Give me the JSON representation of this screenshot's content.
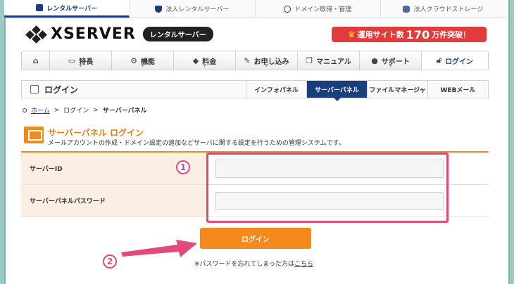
{
  "service_tabs": [
    {
      "label": "レンタルサーバー",
      "icon": "server-icon",
      "active": true
    },
    {
      "label": "法人レンタルサーバー",
      "icon": "shield-icon",
      "active": false
    },
    {
      "label": "ドメイン取得・管理",
      "icon": "globe-icon",
      "active": false
    },
    {
      "label": "法人クラウドストレージ",
      "icon": "database-icon",
      "active": false
    }
  ],
  "header": {
    "logo_text": "XSERVER",
    "logo_badge": "レンタルサーバー",
    "promo_prefix": "運用サイト数",
    "promo_number": "170",
    "promo_suffix": "万件突破！"
  },
  "main_nav": [
    {
      "label": "",
      "icon": "home-icon"
    },
    {
      "label": "特長",
      "icon": "monitor-icon"
    },
    {
      "label": "機能",
      "icon": "tools-icon"
    },
    {
      "label": "料金",
      "icon": "tag-icon"
    },
    {
      "label": "お申し込み",
      "icon": "pen-icon"
    },
    {
      "label": "マニュアル",
      "icon": "book-icon"
    },
    {
      "label": "サポート",
      "icon": "user-icon"
    },
    {
      "label": "ログイン",
      "icon": "lock-icon"
    }
  ],
  "subheader": {
    "title": "ログイン",
    "tabs": [
      "インフォパネル",
      "サーバーパネル",
      "ファイルマネージャ",
      "WEBメール"
    ],
    "active_tab": "サーバーパネル"
  },
  "breadcrumb": {
    "home": "ホーム",
    "login": "ログイン",
    "current": "サーバーパネル",
    "sep": ">"
  },
  "panel": {
    "title": "サーバーパネル ログイン",
    "description": "メールアカウントの作成・ドメイン設定の追加などサーバに関する設定を行うための管理システムです。"
  },
  "form": {
    "server_id_label": "サーバーID",
    "password_label": "サーバーパネルパスワード",
    "server_id_value": "",
    "password_value": ""
  },
  "login_button": "ログイン",
  "forgot": {
    "text": "※パスワードを忘れてしまった方は",
    "link": "こちら"
  },
  "annotations": {
    "step1": "1",
    "step2": "2",
    "highlight_color": "#e24a7b"
  },
  "colors": {
    "brand": "#1a3d7c",
    "accent_orange": "#f4891e",
    "promo_red": "#e23b3b"
  }
}
